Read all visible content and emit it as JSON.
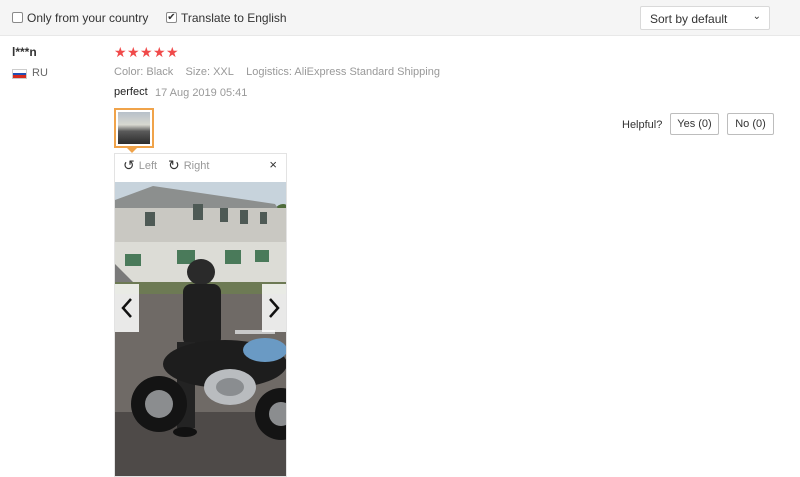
{
  "filters": {
    "only_country": {
      "label": "Only from your country",
      "checked": false
    },
    "translate": {
      "label": "Translate to English",
      "checked": true
    },
    "sort": {
      "value": "Sort by default"
    }
  },
  "review": {
    "user": "l***n",
    "country": "RU",
    "rating": 5,
    "color_label": "Color:",
    "color_value": "Black",
    "size_label": "Size:",
    "size_value": "XXL",
    "logistics_label": "Logistics:",
    "logistics_value": "AliExpress Standard Shipping",
    "text": "perfect",
    "date": "17 Aug 2019 05:41"
  },
  "helpful": {
    "label": "Helpful?",
    "yes": "Yes (0)",
    "no": "No (0)"
  },
  "viewer": {
    "rotate_left": "Left",
    "rotate_right": "Right",
    "close": "×"
  },
  "colors": {
    "star": "#f04a4a",
    "thumb_border": "#f0a34a"
  }
}
